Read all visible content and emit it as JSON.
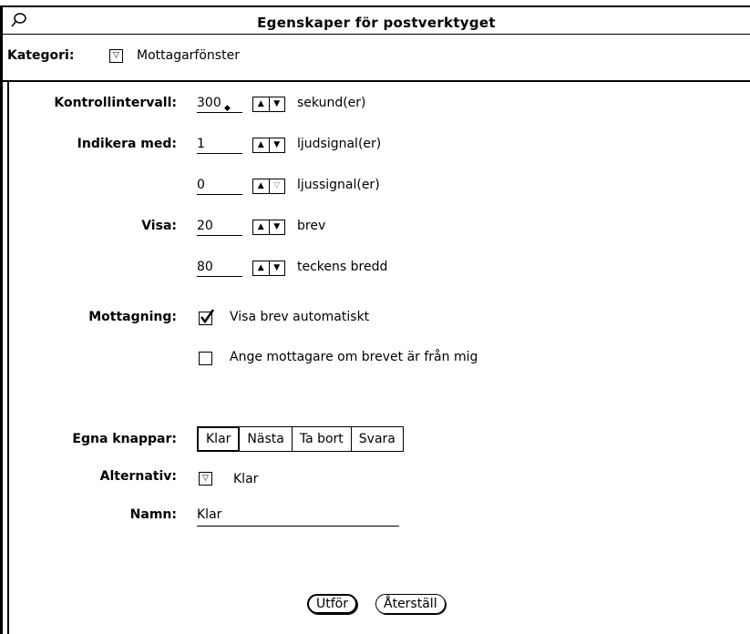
{
  "window": {
    "title": "Egenskaper för postverktyget",
    "icon": "pushpin-icon"
  },
  "category": {
    "label": "Kategori:",
    "value": "Mottagarfönster"
  },
  "check_interval": {
    "label": "Kontrollintervall:",
    "value": "300",
    "unit": "sekund(er)"
  },
  "indicate": {
    "label": "Indikera med:",
    "beeps_value": "1",
    "beeps_unit": "ljudsignal(er)",
    "flashes_value": "0",
    "flashes_unit": "ljussignal(er)"
  },
  "display": {
    "label": "Visa:",
    "headers_value": "20",
    "headers_unit": "brev",
    "width_value": "80",
    "width_unit": "teckens bredd"
  },
  "receiving": {
    "label": "Mottagning:",
    "show_auto_label": "Visa brev automatiskt",
    "show_auto_checked": true,
    "set_recipient_label": "Ange mottagare om brevet är från mig",
    "set_recipient_checked": false
  },
  "custom_buttons": {
    "label": "Egna knappar:",
    "items": [
      "Klar",
      "Nästa",
      "Ta bort",
      "Svara"
    ],
    "selected": "Klar"
  },
  "alternative": {
    "label": "Alternativ:",
    "value": "Klar"
  },
  "name": {
    "label": "Namn:",
    "value": "Klar"
  },
  "actions": {
    "apply_label": "Utför",
    "reset_label": "Återställ"
  }
}
